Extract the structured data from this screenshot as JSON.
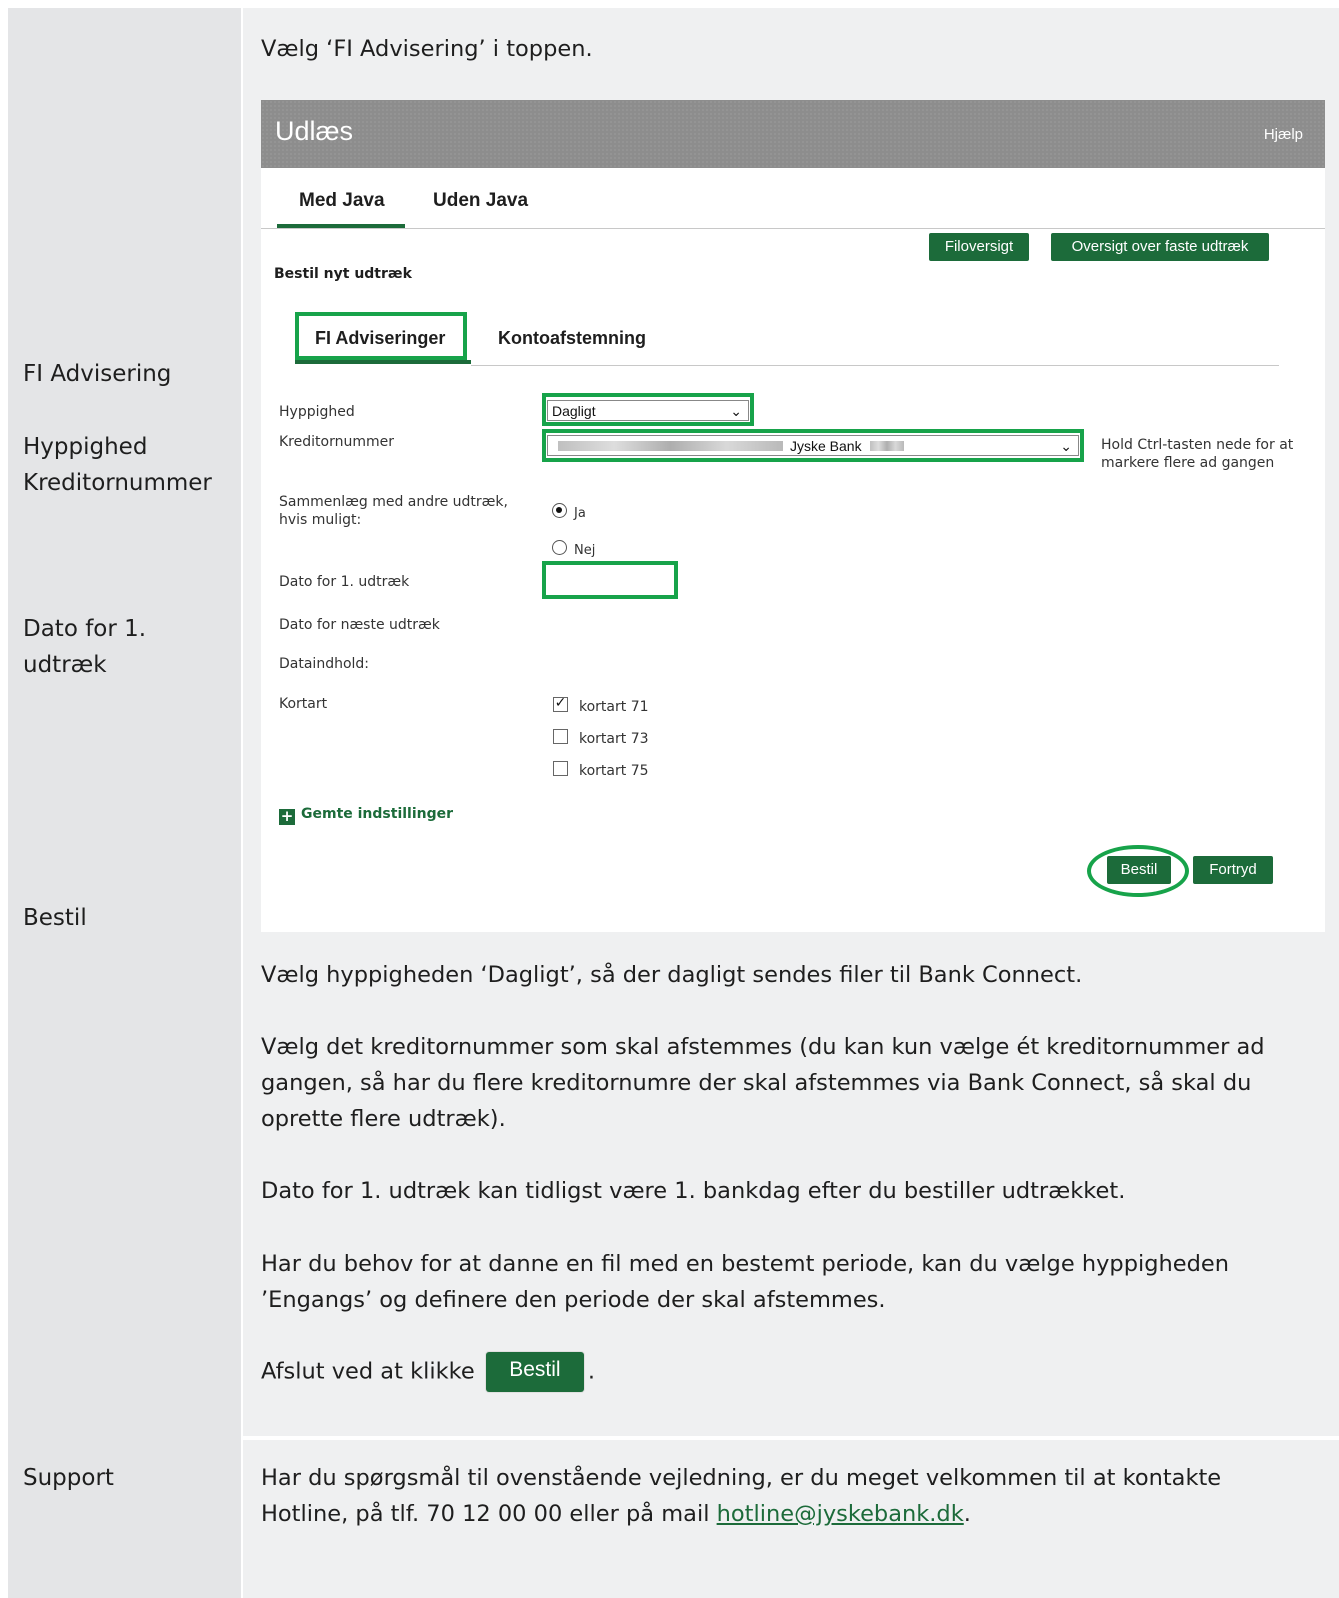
{
  "left_labels": {
    "fi_advisering": "FI Advisering",
    "hyppighed": "Hyppighed",
    "kreditornummer": "Kreditornummer",
    "dato_line1": "Dato for 1.",
    "dato_line2": "udtræk",
    "bestil": "Bestil",
    "support": "Support"
  },
  "intro_text": "Vælg ‘FI Advisering’ i toppen.",
  "screenshot": {
    "title": "Udlæs",
    "help": "Hjælp",
    "tabs": [
      "Med Java",
      "Uden Java"
    ],
    "buttons": {
      "filoversigt": "Filoversigt",
      "oversigt": "Oversigt over faste udtræk"
    },
    "section_title": "Bestil nyt udtræk",
    "subtabs": [
      "FI Adviseringer",
      "Kontoafstemning"
    ],
    "fields": {
      "hyppighed_label": "Hyppighed",
      "hyppighed_value": "Dagligt",
      "kreditor_label": "Kreditornummer",
      "kreditor_value": "Jyske Bank",
      "kreditor_hint": "Hold Ctrl-tasten nede for at markere flere ad gangen",
      "sammenlaeg_label_1": "Sammenlæg med andre udtræk,",
      "sammenlaeg_label_2": "hvis muligt:",
      "radio_ja": "Ja",
      "radio_nej": "Nej",
      "dato_label": "Dato for 1. udtræk",
      "dato_value": "",
      "naeste_label": "Dato for næste udtræk",
      "dataindhold_label": "Dataindhold:",
      "kortart_label": "Kortart",
      "kortart_options": [
        {
          "label": "kortart 71",
          "checked": true
        },
        {
          "label": "kortart 73",
          "checked": false
        },
        {
          "label": "kortart 75",
          "checked": false
        }
      ],
      "gemte": "Gemte indstillinger"
    },
    "action_buttons": {
      "bestil": "Bestil",
      "fortryd": "Fortryd"
    }
  },
  "paragraphs": {
    "p1": "Vælg hyppigheden ‘Dagligt’, så der dagligt sendes filer til Bank Connect.",
    "p2": "Vælg det kreditornummer som skal afstemmes (du kan kun vælge ét kreditornummer ad gangen, så har du flere kreditornumre der skal afstemmes via Bank Connect, så skal du oprette flere udtræk).",
    "p3": "Dato for 1. udtræk kan tidligst være 1. bankdag efter du bestiller udtrækket.",
    "p4": "Har du behov for at danne en fil med en bestemt periode, kan du vælge hyppigheden ’Engangs’ og definere den periode der skal afstemmes.",
    "p5_prefix": "Afslut ved at klikke",
    "p5_button": "Bestil",
    "p5_suffix": "."
  },
  "support": {
    "text": "Har du spørgsmål til ovenstående vejledning, er du meget velkommen til at kontakte Hotline, på tlf. 70 12 00 00 eller på mail ",
    "email": "hotline@jyskebank.dk",
    "suffix": "."
  },
  "colors": {
    "brand_green": "#1c6b3a",
    "highlight_green": "#17a34a",
    "header_gray": "#8d8d8d"
  }
}
